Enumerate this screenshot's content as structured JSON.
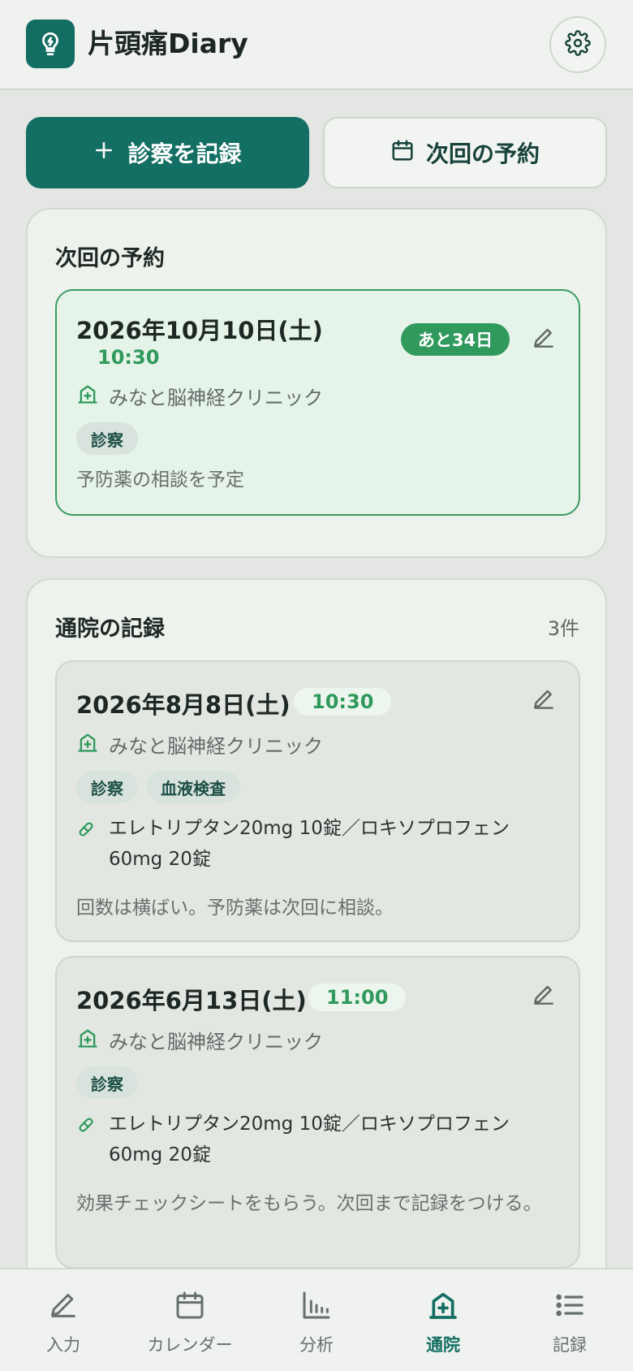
{
  "header": {
    "app_title": "片頭痛Diary",
    "logo_icon": "lightbulb-icon",
    "settings_icon": "gear-icon"
  },
  "actions": {
    "record_visit_label": "診察を記録",
    "next_appointment_label": "次回の予約"
  },
  "next_appointment": {
    "section_title": "次回の予約",
    "date": "2026年10月10日(土)",
    "time": "10:30",
    "days_left": "あと34日",
    "clinic": "みなと脳神経クリニック",
    "tags": [
      "診察"
    ],
    "note": "予防薬の相談を予定"
  },
  "visits": {
    "section_title": "通院の記録",
    "count": "3件",
    "items": [
      {
        "date": "2026年8月8日(土)",
        "time": "10:30",
        "clinic": "みなと脳神経クリニック",
        "tags": [
          "診察",
          "血液検査"
        ],
        "medication": "エレトリプタン20mg 10錠／ロキソプロフェン60mg 20錠",
        "note": "回数は横ばい。予防薬は次回に相談。"
      },
      {
        "date": "2026年6月13日(土)",
        "time": "11:00",
        "clinic": "みなと脳神経クリニック",
        "tags": [
          "診察"
        ],
        "medication": "エレトリプタン20mg 10錠／ロキソプロフェン60mg 20錠",
        "note": "効果チェックシートをもらう。次回まで記録をつける。"
      }
    ]
  },
  "nav": {
    "items": [
      {
        "label": "入力",
        "icon": "pencil-icon"
      },
      {
        "label": "カレンダー",
        "icon": "calendar-icon"
      },
      {
        "label": "分析",
        "icon": "bar-chart-icon"
      },
      {
        "label": "通院",
        "icon": "hospital-icon"
      },
      {
        "label": "記録",
        "icon": "list-icon"
      }
    ],
    "active": "通院"
  },
  "colors": {
    "primary": "#136f63",
    "accent_green": "#2f9a5b",
    "background": "#e3e6e2"
  }
}
